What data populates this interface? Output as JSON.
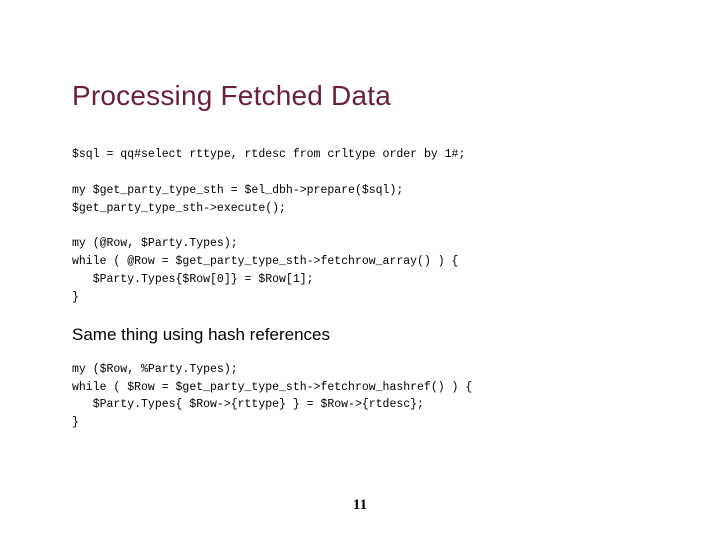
{
  "title": "Processing Fetched Data",
  "code_sql": "$sql = qq#select rttype, rtdesc from crltype order by 1#;",
  "code_prepare": "my $get_party_type_sth = $el_dbh->prepare($sql);\n$get_party_type_sth->execute();",
  "code_fetch_array": "my (@Row, $Party.Types);\nwhile ( @Row = $get_party_type_sth->fetchrow_array() ) {\n   $Party.Types{$Row[0]} = $Row[1];\n}",
  "subheading": "Same thing using hash references",
  "code_fetch_hashref": "my ($Row, %Party.Types);\nwhile ( $Row = $get_party_type_sth->fetchrow_hashref() ) {\n   $Party.Types{ $Row->{rttype} } = $Row->{rtdesc};\n}",
  "page_number": "11"
}
